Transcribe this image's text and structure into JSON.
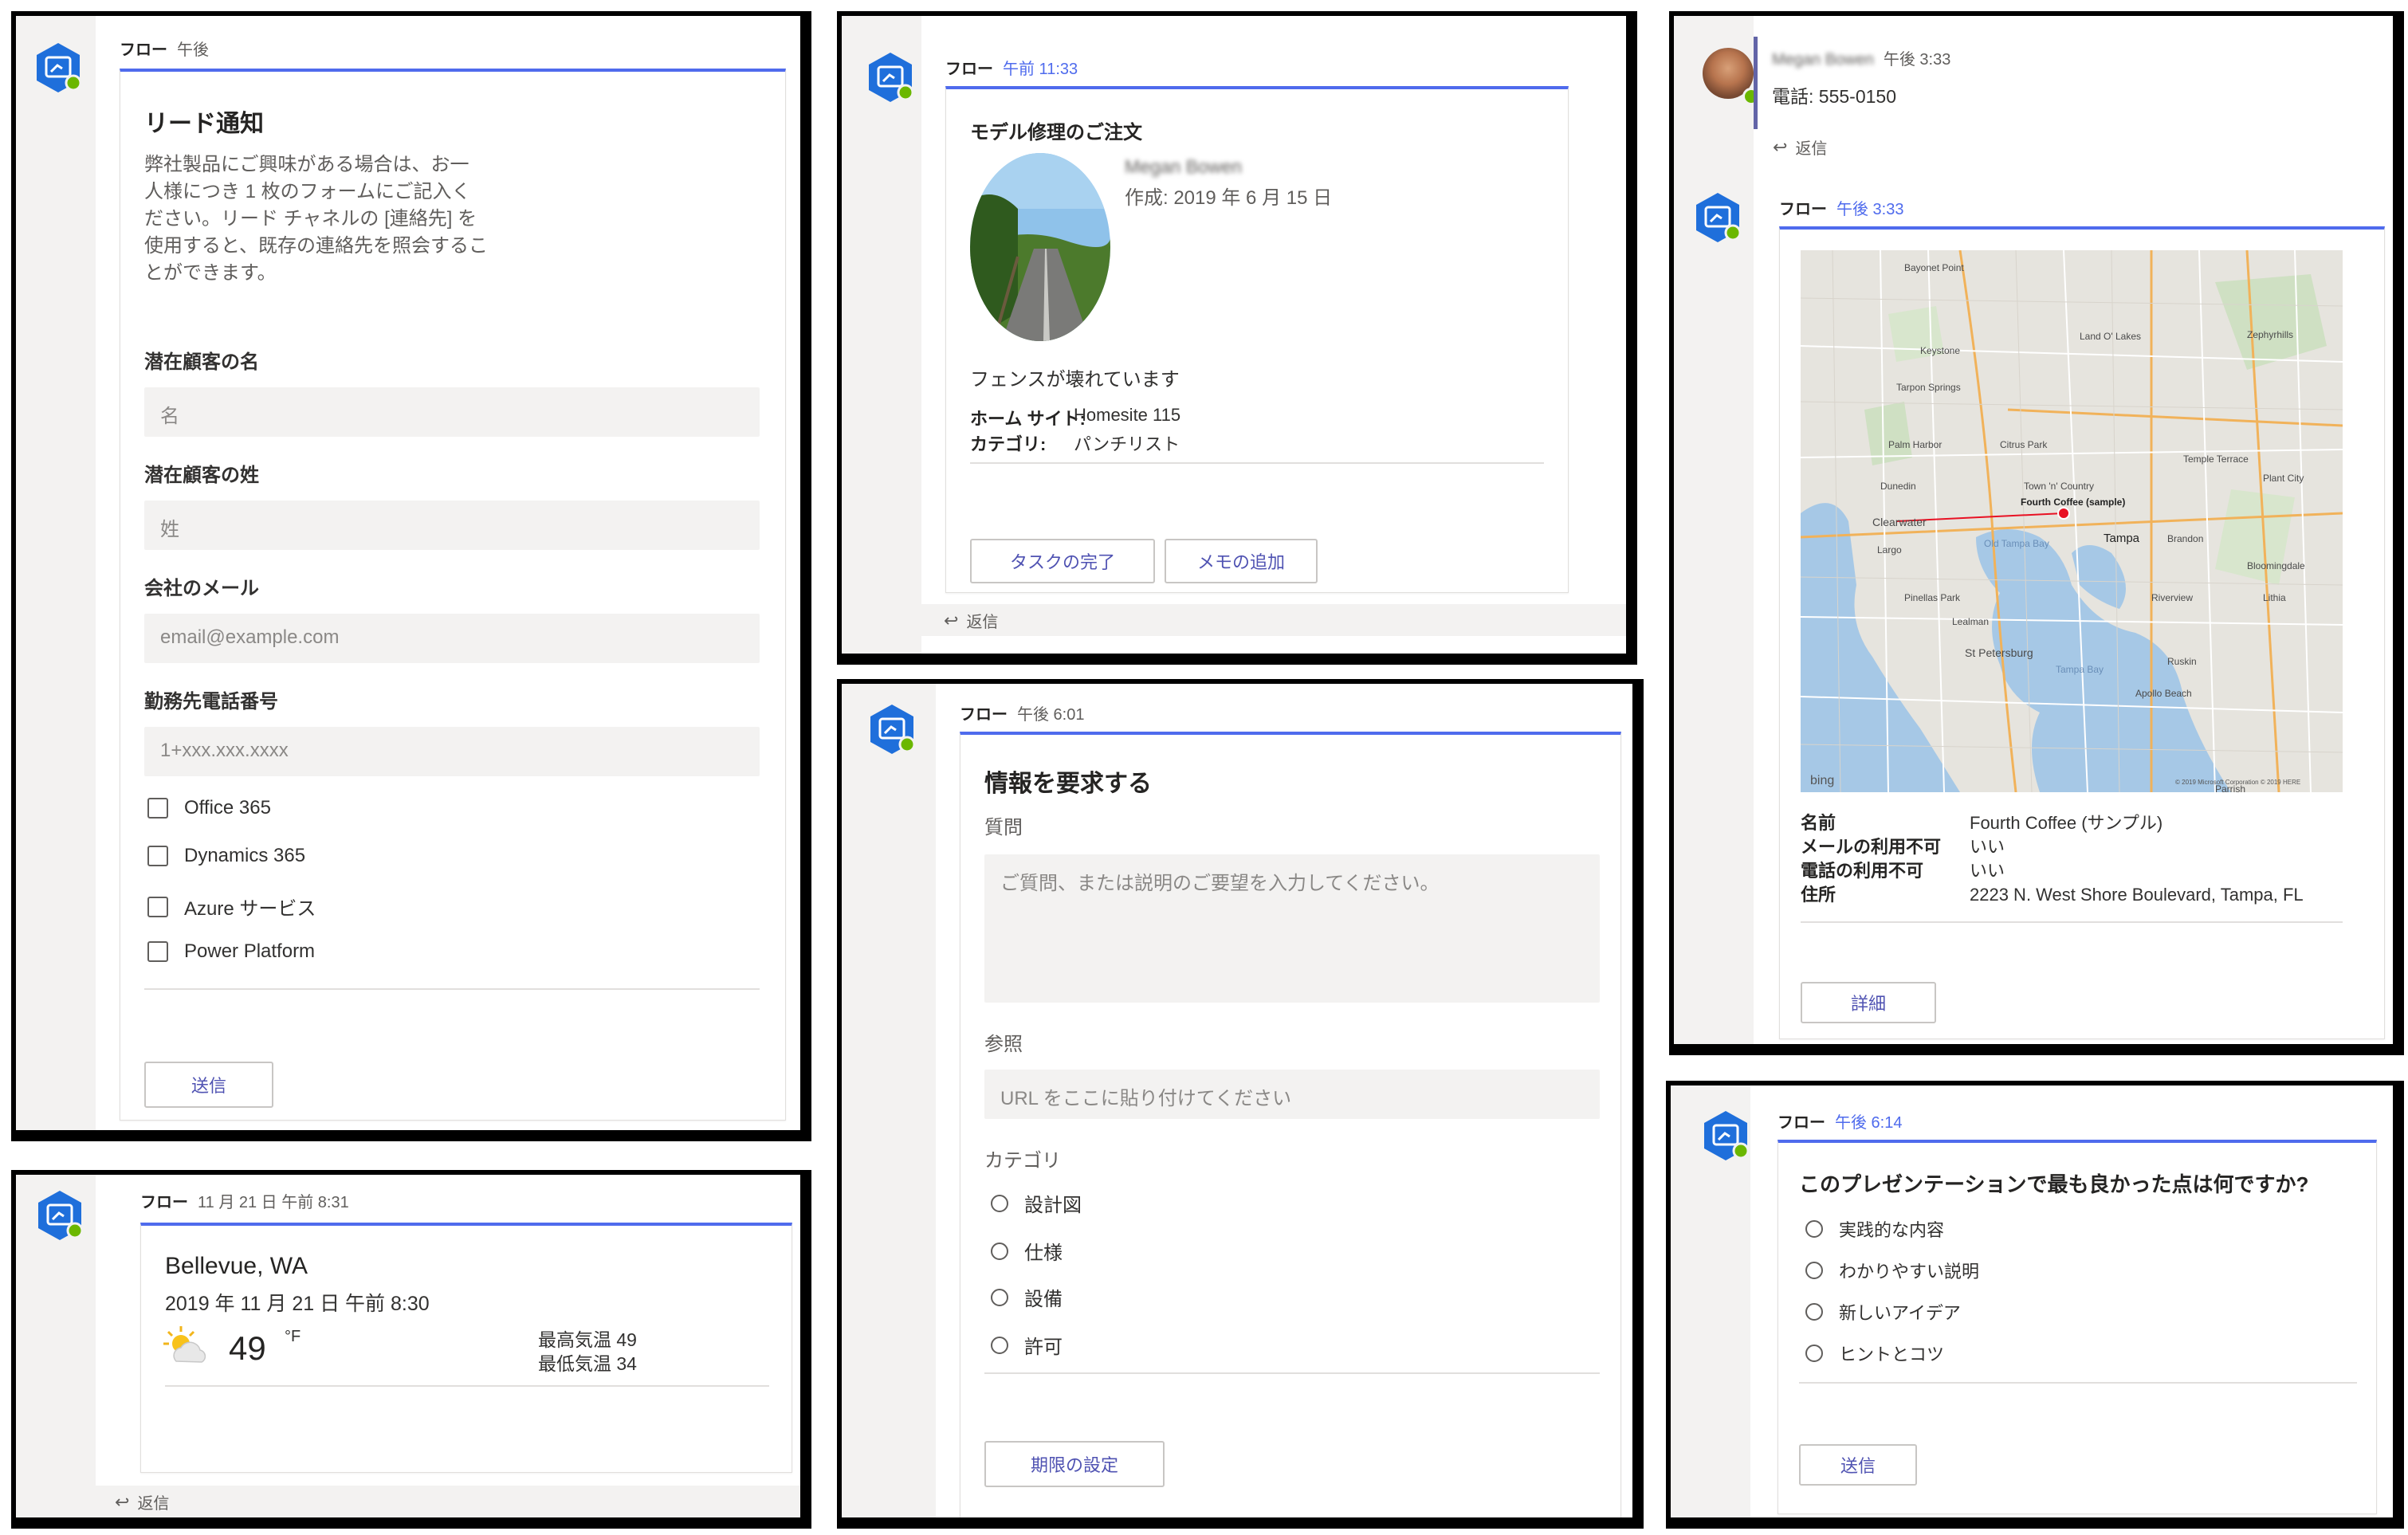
{
  "icons": {
    "bot": "flow-bot-icon",
    "status": "available-status-icon",
    "reply": "reply-arrow-icon",
    "weather": "partly-sunny-icon"
  },
  "colors": {
    "accent": "#4f6bed",
    "bot_blue": "#1f6fdb",
    "status_green": "#6bb700"
  },
  "panel_lead": {
    "sender": "フロー",
    "time": "午後",
    "title": "リード通知",
    "description_lines": [
      "弊社製品にご興味がある場合は、お一",
      "人様につき 1 枚のフォームにご記入く",
      "ださい。リード チャネルの [連絡先] を",
      "使用すると、既存の連絡先を照会するこ",
      "とができます。"
    ],
    "fields": [
      {
        "label": "潜在顧客の名",
        "placeholder": "名"
      },
      {
        "label": "潜在顧客の姓",
        "placeholder": "姓"
      },
      {
        "label": "会社のメール",
        "placeholder": "email@example.com"
      },
      {
        "label": "勤務先電話番号",
        "placeholder": "1+xxx.xxx.xxxx"
      }
    ],
    "checkboxes": [
      "Office 365",
      "Dynamics 365",
      "Azure サービス",
      "Power Platform"
    ],
    "submit": "送信"
  },
  "panel_weather": {
    "sender": "フロー",
    "time": "11 月 21 日 午前 8:31",
    "city": "Bellevue, WA",
    "datetime": "2019 年 11 月 21 日 午前 8:30",
    "temp": "49",
    "unit": "°F",
    "high": "最高気温 49",
    "low": "最低気温 34",
    "reply": "返信"
  },
  "panel_repair": {
    "sender": "フロー",
    "time": "午前 11:33",
    "title": "モデル修理のご注文",
    "person": "Megan Bowen",
    "created": "作成: 2019 年 6 月 15 日",
    "issue": "フェンスが壊れています",
    "facts": [
      {
        "key": "ホーム サイト:",
        "value": "Homesite 115"
      },
      {
        "key": "カテゴリ:",
        "value": "パンチリスト"
      }
    ],
    "buttons": [
      "タスクの完了",
      "メモの追加"
    ],
    "reply": "返信"
  },
  "panel_info": {
    "sender": "フロー",
    "time": "午後 6:01",
    "title": "情報を要求する",
    "question_label": "質問",
    "question_placeholder": "ご質問、または説明のご要望を入力してください。",
    "ref_label": "参照",
    "ref_placeholder": "URL をここに貼り付けてください",
    "category_label": "カテゴリ",
    "options": [
      "設計図",
      "仕様",
      "設備",
      "許可"
    ],
    "due_button": "期限の設定"
  },
  "panel_map": {
    "user_name": "Megan Bowen",
    "user_time": "午後 3:33",
    "phone": "電話: 555-0150",
    "reply": "返信",
    "sender": "フロー",
    "time": "午後 3:33",
    "map_labels": [
      "Land O' Lakes",
      "Zephyrhills",
      "Tarpon Springs",
      "Palm Harbor",
      "Citrus Park",
      "Temple Terrace",
      "Dunedin",
      "Town 'n' Country",
      "Fourth Coffee (sample)",
      "Clearwater",
      "Tampa",
      "Brandon",
      "Plant City",
      "Largo",
      "Old Tampa Bay",
      "Riverview",
      "Pinellas Park",
      "St Petersburg",
      "Tampa Bay",
      "Ruskin",
      "Bloomingdale",
      "Lithia",
      "Lealman",
      "Keystone",
      "Parrish",
      "Apollo Beach",
      "Bayonet Point"
    ],
    "map_logo": "bing",
    "map_copyright": "© 2019 Microsoft Corporation © 2019 HERE",
    "facts": [
      {
        "key": "名前",
        "value": "Fourth Coffee (サンプル)"
      },
      {
        "key": "メールの利用不可",
        "value": "いい"
      },
      {
        "key": "電話の利用不可",
        "value": "いい"
      },
      {
        "key": "住所",
        "value": "2223 N. West Shore Boulevard, Tampa, FL"
      }
    ],
    "details_button": "詳細"
  },
  "panel_poll": {
    "sender": "フロー",
    "time": "午後 6:14",
    "title": "このプレゼンテーションで最も良かった点は何ですか?",
    "options": [
      "実践的な内容",
      "わかりやすい説明",
      "新しいアイデア",
      "ヒントとコツ"
    ],
    "submit": "送信"
  }
}
